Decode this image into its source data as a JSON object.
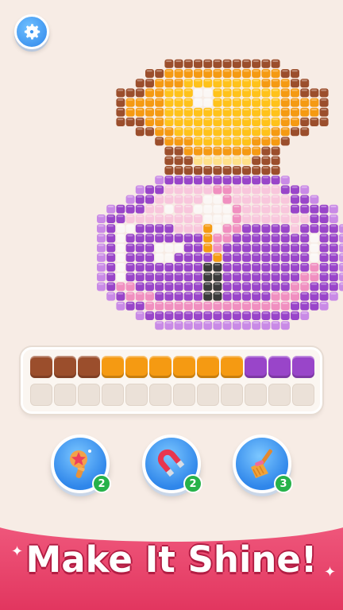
{
  "settings": {
    "icon": "gear-icon"
  },
  "colors": {
    "background": "#f7ece5",
    "brown": "#9b4e2c",
    "orange": "#f59a12",
    "yellow": "#ffc21a",
    "light_yellow": "#ffe08a",
    "white": "#fbf7f5",
    "purple": "#9945c9",
    "light_purple": "#c98ae6",
    "pink": "#f08fc0",
    "light_pink": "#f8c6dc",
    "dark": "#3a3a3a",
    "accent_blue": "#2f86ea",
    "badge_green": "#27b24a",
    "banner_pink": "#e2365f"
  },
  "tray": {
    "filled": [
      "brown",
      "brown",
      "brown",
      "orange",
      "orange",
      "orange",
      "orange",
      "orange",
      "orange",
      "purple",
      "purple",
      "purple"
    ],
    "empty_count": 12
  },
  "boosters": [
    {
      "name": "magic-wand",
      "icon": "magic-wand-icon",
      "count": "2"
    },
    {
      "name": "magnet",
      "icon": "magnet-icon",
      "count": "2"
    },
    {
      "name": "broom",
      "icon": "broom-icon",
      "count": "3"
    }
  ],
  "banner": {
    "title": "Make It Shine!"
  }
}
